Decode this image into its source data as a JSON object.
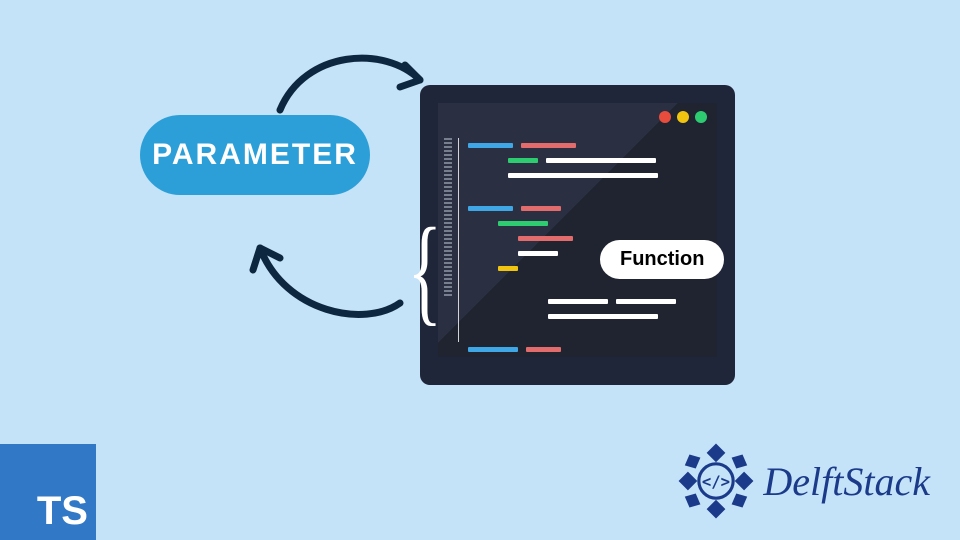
{
  "pill_label": "PARAMETER",
  "function_label": "Function",
  "ts_label": "TS",
  "brand_name": "DelftStack",
  "colors": {
    "background": "#c4e3f8",
    "pill": "#2d9fd8",
    "ts_badge": "#3178c6",
    "brand_text": "#1b3a8a",
    "arrow": "#0e2740",
    "window_frame": "#20263a",
    "window_body": "#2a3041"
  },
  "window": {
    "dots": [
      "red",
      "yellow",
      "green"
    ]
  },
  "icons": {
    "arrow_top": "curved-arrow-right-icon",
    "arrow_bottom": "curved-arrow-left-icon",
    "brace": "curly-brace-icon",
    "brand_logo": "delftstack-logo-icon"
  }
}
